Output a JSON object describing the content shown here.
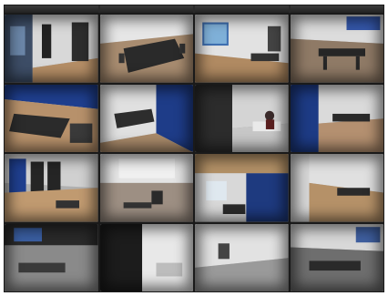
{
  "cameras": [
    {
      "tile": "r1c1",
      "stamp": ""
    },
    {
      "tile": "r1c2",
      "stamp": ""
    },
    {
      "tile": "r1c3",
      "stamp": ""
    },
    {
      "tile": "r1c4",
      "stamp": ""
    },
    {
      "tile": "r2c1",
      "stamp": ""
    },
    {
      "tile": "r2c2",
      "stamp": ""
    },
    {
      "tile": "r2c3",
      "stamp": ""
    },
    {
      "tile": "r2c4",
      "stamp": ""
    },
    {
      "tile": "r3c1",
      "stamp": ""
    },
    {
      "tile": "r3c2",
      "stamp": ""
    },
    {
      "tile": "r3c3",
      "stamp": ""
    },
    {
      "tile": "r3c4",
      "stamp": ""
    },
    {
      "tile": "r4c1",
      "stamp": ""
    },
    {
      "tile": "r4c2",
      "stamp": ""
    },
    {
      "tile": "r4c3",
      "stamp": ""
    },
    {
      "tile": "r4c4",
      "stamp": ""
    }
  ],
  "colors": {
    "wall_blue": "#1f3f8f",
    "floor_wood": "#b8916a",
    "wall_white": "#d9d9d9",
    "dark": "#222222"
  }
}
